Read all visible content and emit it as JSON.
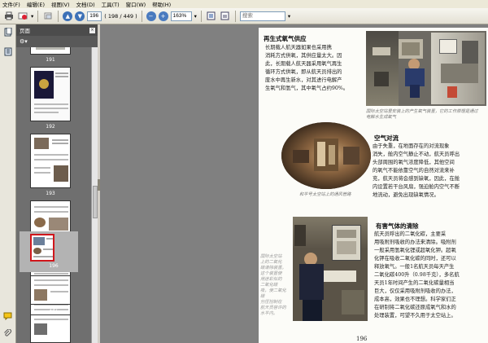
{
  "menu": [
    "文件(F)",
    "编辑(E)",
    "视图(V)",
    "文档(D)",
    "工具(T)",
    "窗口(W)",
    "帮助(H)"
  ],
  "toolbar": {
    "page_input": "196",
    "page_count": "( 198 / 449 )",
    "zoom_value": "163%",
    "search_placeholder": "搜索"
  },
  "panel": {
    "title": "页面",
    "close": "×"
  },
  "thumbnails": [
    {
      "label": "191"
    },
    {
      "label": "192"
    },
    {
      "label": "193"
    },
    {
      "label": "194"
    },
    {
      "label": "195"
    },
    {
      "label": "196"
    },
    {
      "label": "197"
    }
  ],
  "document": {
    "sec1_title": "再生式氧气供应",
    "sec1_lines": [
      "长期载人航天器如果也采用携",
      "消耗方式供氧，其供应量太大。因",
      "此，长期载人航天器采用氧气再生",
      "循环方式供氧，即从航天员排出的",
      "废水中再生新水，对其进行电解产",
      "生氧气和氢气，其中氧气占约90%。"
    ],
    "caption1": "国际太空站里安装上的产生氧气装置，它的工作原理是通过电解水生成氧气",
    "sec2_title": "空气对流",
    "sec2_lines": [
      "由于失重，在地面存在的对流现象",
      "消失，舱内空气静止不动，航天员呼出",
      "头部周围的氧气浓度降低，其他空间",
      "的氧气不能依靠空气的自然对流来补",
      "充，航天员将会感到缺氧，因此，在舱",
      "内设置若干台风扇，强迫舱内空气不断",
      "地流动，避免出现缺氧情况。"
    ],
    "caption2": "和平号太空站上的通风管路",
    "sec3_title": "有害气体的清除",
    "sec3_lines": [
      "航天员呼出的二氧化碳，主要采",
      "用吸附剂吸收的办法来清除。吸附剂",
      "一般采用氢氧化锂或超氧化钾。超氧",
      "化钾在吸收二氧化碳的同时，还可以",
      "释放氧气。一般1名航天员每天产生",
      "二氧化碳400升（0.98千克），多名航",
      "天员1年时间产生的二氧化碳量相当",
      "巨大，仅仅采用吸附剂吸收的办法，",
      "成本高，效果也不理想。科学家们正",
      "在研制将二氧化碳还原成氧气和水的",
      "处理装置，可望不久用于太空站上。"
    ],
    "caption3_lines": [
      "国际太空站",
      "上的二氧化",
      "碳清除装置。",
      "这个装置使",
      "用迷彩似的",
      "二氧化碳",
      "吸，使二氧化碳",
      "分压控制在",
      "航天员容许的",
      "水平内。"
    ],
    "page_number": "196"
  },
  "colors": {
    "panel_bg": "#6f6f6f",
    "viewer_bg": "#808080",
    "selected_border": "#d0161b"
  }
}
